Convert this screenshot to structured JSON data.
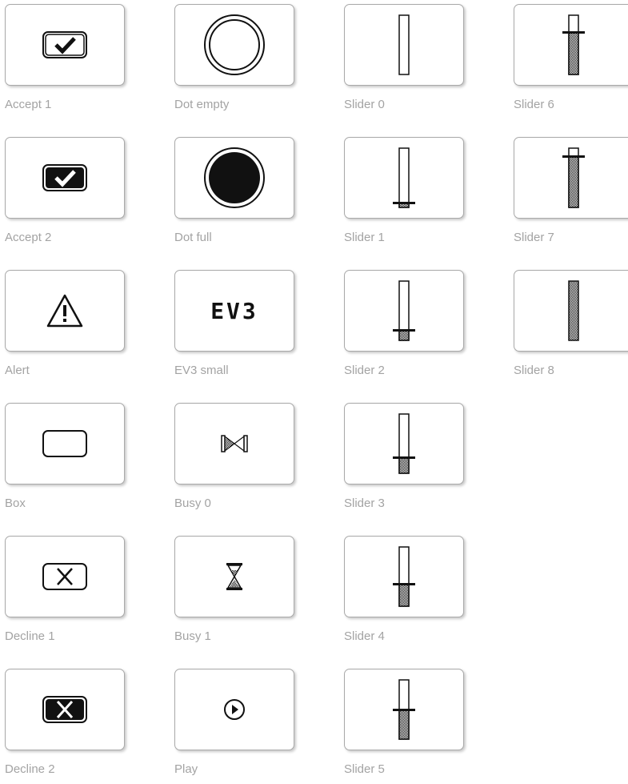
{
  "icons": [
    {
      "label": "Accept 1",
      "icon": "accept-1-icon"
    },
    {
      "label": "Accept 2",
      "icon": "accept-2-icon"
    },
    {
      "label": "Alert",
      "icon": "alert-icon"
    },
    {
      "label": "Box",
      "icon": "box-icon"
    },
    {
      "label": "Decline 1",
      "icon": "decline-1-icon"
    },
    {
      "label": "Decline 2",
      "icon": "decline-2-icon"
    },
    {
      "label": "Dot empty",
      "icon": "dot-empty-icon"
    },
    {
      "label": "Dot full",
      "icon": "dot-full-icon"
    },
    {
      "label": "EV3 small",
      "icon": "ev3-small-icon"
    },
    {
      "label": "Busy 0",
      "icon": "busy-0-icon"
    },
    {
      "label": "Busy 1",
      "icon": "busy-1-icon"
    },
    {
      "label": "Play",
      "icon": "play-icon"
    },
    {
      "label": "Slider 0",
      "icon": "slider-0-icon"
    },
    {
      "label": "Slider 1",
      "icon": "slider-1-icon"
    },
    {
      "label": "Slider 2",
      "icon": "slider-2-icon"
    },
    {
      "label": "Slider 3",
      "icon": "slider-3-icon"
    },
    {
      "label": "Slider 4",
      "icon": "slider-4-icon"
    },
    {
      "label": "Slider 5",
      "icon": "slider-5-icon"
    },
    {
      "label": "Slider 6",
      "icon": "slider-6-icon"
    },
    {
      "label": "Slider 7",
      "icon": "slider-7-icon"
    },
    {
      "label": "Slider 8",
      "icon": "slider-8-icon"
    }
  ],
  "ev3_text": "EV3"
}
